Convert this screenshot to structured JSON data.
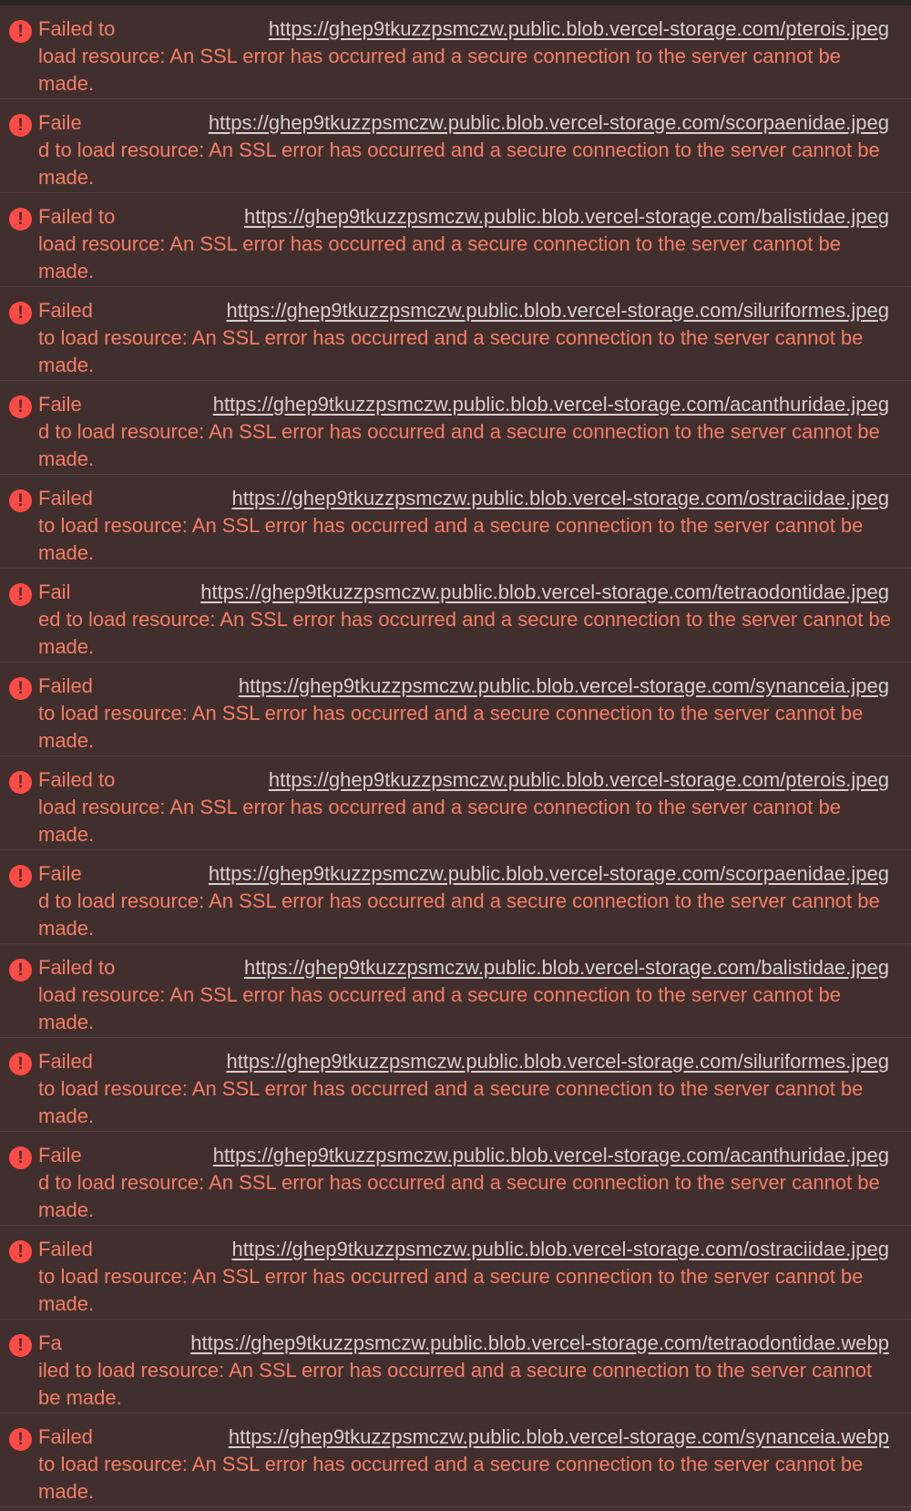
{
  "console": {
    "icon": "error-icon",
    "colors": {
      "background": "#412f2d",
      "message": "#f57e67",
      "url": "#d8cfcc",
      "icon": "#ff4b46"
    },
    "entries": [
      {
        "head": "Failed to",
        "url": "https://ghep9tkuzzpsmczw.public.blob.vercel-storage.com/pterois.jpeg",
        "rest": "load resource: An SSL error has occurred and a secure connection to the server cannot be made."
      },
      {
        "head": "Faile",
        "url": "https://ghep9tkuzzpsmczw.public.blob.vercel-storage.com/scorpaenidae.jpeg",
        "rest": "d to load resource: An SSL error has occurred and a secure connection to the server cannot be made."
      },
      {
        "head": "Failed to",
        "url": "https://ghep9tkuzzpsmczw.public.blob.vercel-storage.com/balistidae.jpeg",
        "rest": "load resource: An SSL error has occurred and a secure connection to the server cannot be made."
      },
      {
        "head": "Failed",
        "url": "https://ghep9tkuzzpsmczw.public.blob.vercel-storage.com/siluriformes.jpeg",
        "rest": "to load resource: An SSL error has occurred and a secure connection to the server cannot be made."
      },
      {
        "head": "Faile",
        "url": "https://ghep9tkuzzpsmczw.public.blob.vercel-storage.com/acanthuridae.jpeg",
        "rest": "d to load resource: An SSL error has occurred and a secure connection to the server cannot be made."
      },
      {
        "head": "Failed",
        "url": "https://ghep9tkuzzpsmczw.public.blob.vercel-storage.com/ostraciidae.jpeg",
        "rest": "to load resource: An SSL error has occurred and a secure connection to the server cannot be made."
      },
      {
        "head": "Fail",
        "url": "https://ghep9tkuzzpsmczw.public.blob.vercel-storage.com/tetraodontidae.jpeg",
        "rest": "ed to load resource: An SSL error has occurred and a secure connection to the server cannot be made."
      },
      {
        "head": "Failed",
        "url": "https://ghep9tkuzzpsmczw.public.blob.vercel-storage.com/synanceia.jpeg",
        "rest": "to load resource: An SSL error has occurred and a secure connection to the server cannot be made."
      },
      {
        "head": "Failed to",
        "url": "https://ghep9tkuzzpsmczw.public.blob.vercel-storage.com/pterois.jpeg",
        "rest": "load resource: An SSL error has occurred and a secure connection to the server cannot be made."
      },
      {
        "head": "Faile",
        "url": "https://ghep9tkuzzpsmczw.public.blob.vercel-storage.com/scorpaenidae.jpeg",
        "rest": "d to load resource: An SSL error has occurred and a secure connection to the server cannot be made."
      },
      {
        "head": "Failed to",
        "url": "https://ghep9tkuzzpsmczw.public.blob.vercel-storage.com/balistidae.jpeg",
        "rest": "load resource: An SSL error has occurred and a secure connection to the server cannot be made."
      },
      {
        "head": "Failed",
        "url": "https://ghep9tkuzzpsmczw.public.blob.vercel-storage.com/siluriformes.jpeg",
        "rest": "to load resource: An SSL error has occurred and a secure connection to the server cannot be made."
      },
      {
        "head": "Faile",
        "url": "https://ghep9tkuzzpsmczw.public.blob.vercel-storage.com/acanthuridae.jpeg",
        "rest": "d to load resource: An SSL error has occurred and a secure connection to the server cannot be made."
      },
      {
        "head": "Failed",
        "url": "https://ghep9tkuzzpsmczw.public.blob.vercel-storage.com/ostraciidae.jpeg",
        "rest": "to load resource: An SSL error has occurred and a secure connection to the server cannot be made."
      },
      {
        "head": "Fa",
        "url": "https://ghep9tkuzzpsmczw.public.blob.vercel-storage.com/tetraodontidae.webp",
        "rest": "iled to load resource: An SSL error has occurred and a secure connection to the server cannot be made."
      },
      {
        "head": "Failed",
        "url": "https://ghep9tkuzzpsmczw.public.blob.vercel-storage.com/synanceia.webp",
        "rest": "to load resource: An SSL error has occurred and a secure connection to the server cannot be made."
      }
    ]
  }
}
